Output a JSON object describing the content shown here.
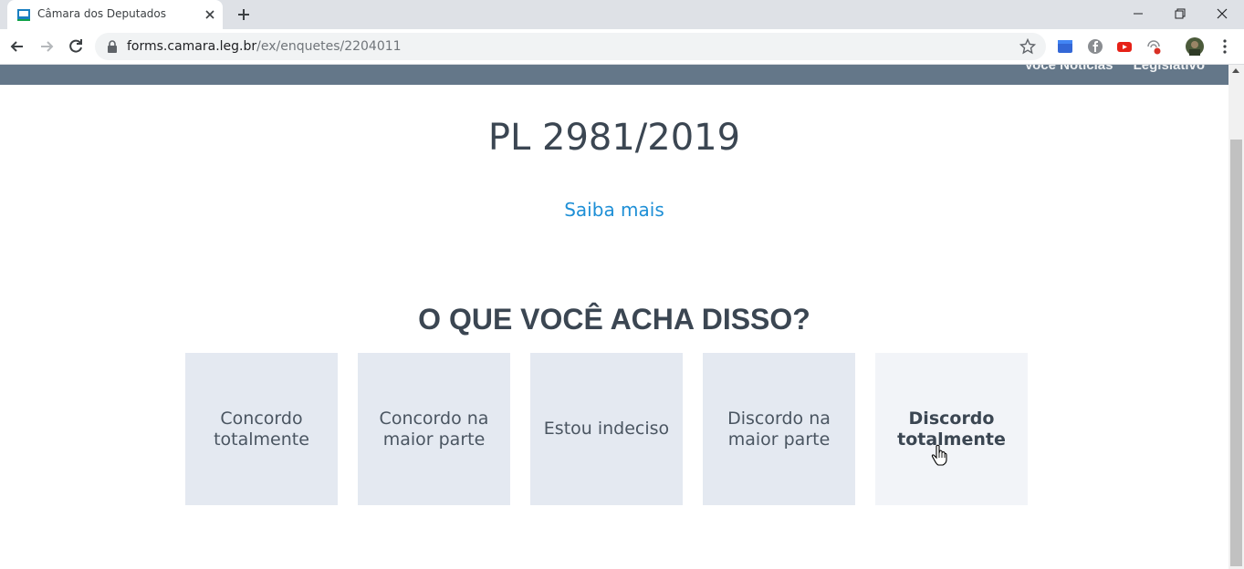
{
  "browser": {
    "tab_title": "Câmara dos Deputados",
    "url_host": "forms.camara.leg.br",
    "url_path": "/ex/enquetes/2204011",
    "icons": {
      "favicon": "camara-favicon-icon",
      "close": "close-icon",
      "new_tab": "plus-icon",
      "back": "arrow-left-icon",
      "forward": "arrow-right-icon",
      "reload": "reload-icon",
      "lock": "lock-icon",
      "bookmark": "star-icon",
      "menu": "kebab-menu-icon"
    }
  },
  "header": {
    "links": [
      "Você Notícias",
      "Legislativo"
    ]
  },
  "poll": {
    "bill_title": "PL 2981/2019",
    "more_link": "Saiba mais",
    "question": "O QUE VOCÊ ACHA DISSO?",
    "options": [
      {
        "label": "Concordo totalmente"
      },
      {
        "label": "Concordo na maior parte"
      },
      {
        "label": "Estou indeciso"
      },
      {
        "label": "Discordo na maior parte"
      },
      {
        "label": "Discordo totalmente"
      }
    ]
  },
  "colors": {
    "header_bg": "#647789",
    "option_bg": "#e4e9f1",
    "option_hover_bg": "#f2f4f8",
    "title_text": "#3b4652",
    "link": "#1e8fd6"
  }
}
